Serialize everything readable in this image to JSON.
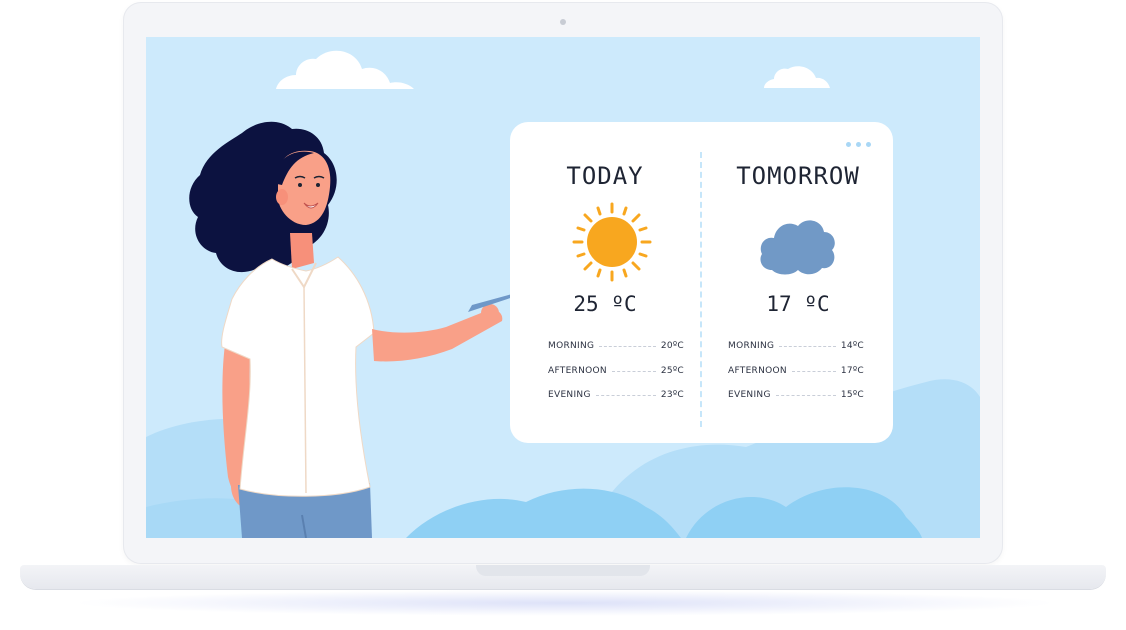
{
  "today": {
    "title": "TODAY",
    "icon": "sun-icon",
    "temperature": "25 ºC",
    "rows": [
      {
        "label": "MORNING",
        "value": "20ºC"
      },
      {
        "label": "AFTERNOON",
        "value": "25ºC"
      },
      {
        "label": "EVENING",
        "value": "23ºC"
      }
    ]
  },
  "tomorrow": {
    "title": "TOMORROW",
    "icon": "cloud-icon",
    "temperature": "17 ºC",
    "rows": [
      {
        "label": "MORNING",
        "value": "14ºC"
      },
      {
        "label": "AFTERNOON",
        "value": "17ºC"
      },
      {
        "label": "EVENING",
        "value": "15ºC"
      }
    ]
  },
  "colors": {
    "sky": "#cdeafc",
    "sun": "#f8a71f",
    "cloud": "#7199c6",
    "hair": "#0c1240"
  }
}
